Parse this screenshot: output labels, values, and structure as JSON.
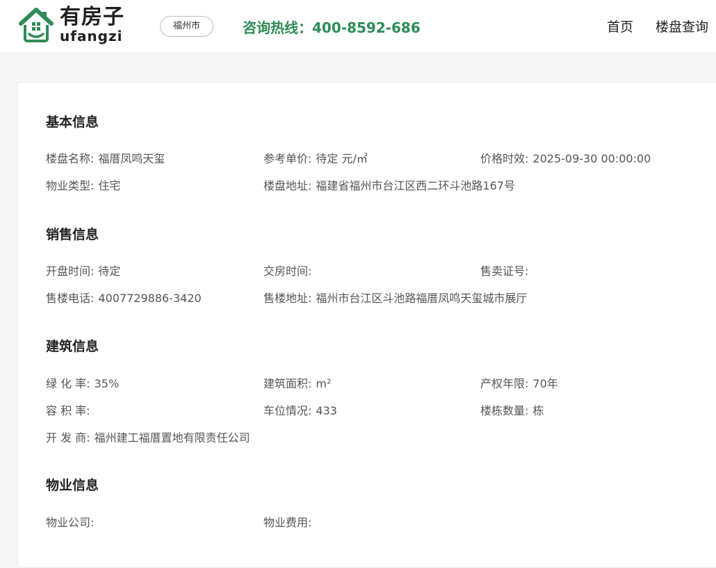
{
  "header": {
    "logo": {
      "cn": "有房子",
      "en": "ufangzi",
      "brand_color": "#2e8b57"
    },
    "city": "福州市",
    "hotline_label": "咨询热线：",
    "hotline_number": "400-8592-686",
    "nav": [
      {
        "label": "首页"
      },
      {
        "label": "楼盘查询"
      }
    ]
  },
  "sections": {
    "basic": {
      "title": "基本信息",
      "rows": [
        [
          {
            "label": "楼盘名称:",
            "value": "福厝凤鸣天玺"
          },
          {
            "label": "参考单价:",
            "value": "待定 元/㎡"
          },
          {
            "label": "价格时效:",
            "value": "2025-09-30 00:00:00"
          }
        ],
        [
          {
            "label": "物业类型:",
            "value": "住宅"
          },
          {
            "label": "楼盘地址:",
            "value": "福建省福州市台江区西二环斗池路167号"
          }
        ]
      ]
    },
    "sales": {
      "title": "销售信息",
      "rows": [
        [
          {
            "label": "开盘时间:",
            "value": "待定"
          },
          {
            "label": "交房时间:",
            "value": ""
          },
          {
            "label": "售卖证号:",
            "value": ""
          }
        ],
        [
          {
            "label": "售楼电话:",
            "value": "4007729886-3420"
          },
          {
            "label": "售楼地址:",
            "value": "福州市台江区斗池路福厝凤鸣天玺城市展厅"
          }
        ]
      ]
    },
    "building": {
      "title": "建筑信息",
      "rows": [
        [
          {
            "label": "绿 化 率:",
            "value": "35%"
          },
          {
            "label": "建筑面积:",
            "value": "m²"
          },
          {
            "label": "产权年限:",
            "value": "70年"
          }
        ],
        [
          {
            "label": "容 积 率:",
            "value": ""
          },
          {
            "label": "车位情况:",
            "value": "433"
          },
          {
            "label": "楼栋数量:",
            "value": "栋"
          }
        ],
        [
          {
            "label": "开 发 商:",
            "value": "福州建工福厝置地有限责任公司"
          }
        ]
      ]
    },
    "property": {
      "title": "物业信息",
      "rows": [
        [
          {
            "label": "物业公司:",
            "value": ""
          },
          {
            "label": "物业费用:",
            "value": ""
          }
        ]
      ]
    }
  }
}
